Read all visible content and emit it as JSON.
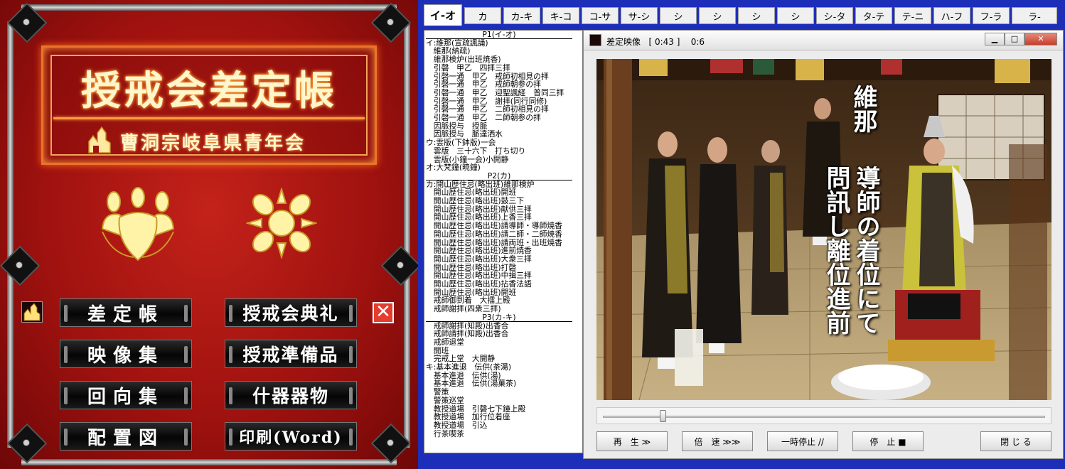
{
  "menu": {
    "title": "授戒会差定帳",
    "subtitle": "曹洞宗岐阜県青年会",
    "buttons": {
      "sajo": "差定帳",
      "eizo": "映像集",
      "eko": "回向集",
      "haichi": "配置図",
      "tenrei": "授戒会典礼",
      "junbi": "授戒準備品",
      "jukki": "什器器物",
      "print": "印刷(Word)"
    },
    "close_icon": "close-x-icon",
    "colors": {
      "bg": "#a0120f",
      "frame": "#e8762a",
      "text": "#fff6cc"
    }
  },
  "tabs": [
    "イ-オ",
    "カ",
    "カ-キ",
    "キ-コ",
    "コ-サ",
    "サ-シ",
    "シ",
    "シ",
    "シ",
    "シ",
    "シ-タ",
    "タ-テ",
    "テ-ニ",
    "ハ-フ",
    "フ-ラ",
    "ラ-"
  ],
  "active_tab": 0,
  "sections": [
    {
      "header": "P1(イ-オ)",
      "lines": [
        "イ:維那(宣疏諷誦)",
        "　維那(納疏)",
        "　維那検炉(出班焼香)",
        "　引磬　甲乙　四拝三拝",
        "　引磬一通　甲乙　戒師初相見の拝",
        "　引磬一通　甲乙　戒師朝参の拝",
        "　引磬一通　甲乙　迎聖諷経　普同三拝",
        "　引磬一通　甲乙　謝拝(同行同修)",
        "　引磬一通　甲乙　二師初相見の拝",
        "　引磬一通　甲乙　二師朝参の拝",
        "　因脈授与　授脈",
        "　因脈授与　脈達洒水",
        "ウ:雲版(下鉢版)一会",
        "　雲版　三十六下　打ち切り",
        "　雲版(小鐘一会)小開静",
        "オ:大梵鐘(暁鐘)"
      ]
    },
    {
      "header": "P2(カ)",
      "lines": [
        "カ:開山歴住忌(略出班)維那検炉",
        "　開山歴住忌(略出班)開班",
        "　開山歴住忌(略出班)鼓三下",
        "　開山歴住忌(略出班)献供三拝",
        "　開山歴住忌(略出班)上香三拝",
        "　開山歴住忌(略出班)請導師・導師焼香",
        "　開山歴住忌(略出班)請二師・二師焼香",
        "　開山歴住忌(略出班)請両班・出班焼香",
        "　開山歴住忌(略出班)進前焼香",
        "　開山歴住忌(略出班)大衆三拝",
        "　開山歴住忌(略出班)打磬",
        "　開山歴住忌(略出班)中揖三拝",
        "　開山歴住忌(略出班)拈香法語",
        "　開山歴住忌(略出班)開班",
        "　戒師御到着　大擂上殿",
        "　戒師謝拝(四衆三拝)"
      ]
    },
    {
      "header": "P3(カ-キ)",
      "lines": [
        "　戒師謝拝(知殿)出香合",
        "　戒師請拝(知殿)出香合",
        "　戒師退堂",
        "　開班",
        "　完戒上堂　大開静",
        "キ:基本進退　伝供(茶湯)",
        "　基本進退　伝供(湯)",
        "　基本進退　伝供(湯菓茶)",
        "　警策",
        "　警策巡堂",
        "　教授道場　引磬七下鐘上殿",
        "　教授道場　加行位着座",
        "　教授道場　引込",
        "　行茶喫茶"
      ]
    }
  ],
  "player": {
    "title": "差定映像",
    "time": "[ 0:43 ]",
    "counter": "0:6",
    "caption_right": "維那",
    "caption_left_1": "導師の着位にて",
    "caption_left_2": "問訊し離位進前",
    "seek_fraction": 0.13,
    "buttons": {
      "play": "再　生 ≫",
      "fast": "倍　速 ≫≫",
      "pause": "一時停止 //",
      "stop": "停　止 ■",
      "close": "閉 じ る"
    },
    "window_controls": [
      "minimize-icon",
      "maximize-icon",
      "close-icon"
    ]
  }
}
